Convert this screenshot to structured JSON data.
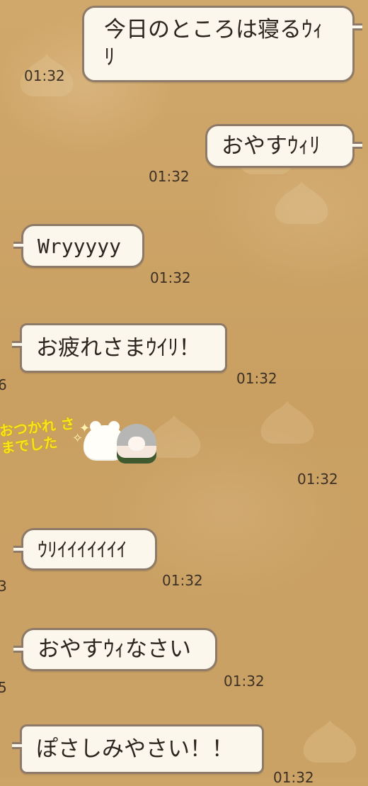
{
  "messages": [
    {
      "text": "今日のところは寝るｳｨﾘ",
      "time": "01:32"
    },
    {
      "text": "おやすｳｨﾘ",
      "time": "01:32"
    },
    {
      "text": "Wryyyyy",
      "time": "01:32"
    },
    {
      "text": "お疲れさまｳｲﾘ！",
      "time": "01:32"
    },
    {
      "sticker_text": "おつかれ\nさまでした",
      "time": "01:32"
    },
    {
      "text": "ｳﾘｲｲｲｲｲｲｲ",
      "time": "01:32"
    },
    {
      "text": "おやすｳｨなさい",
      "time": "01:32"
    },
    {
      "text": "ぽさしみやさい！！",
      "time": "01:32"
    }
  ],
  "cut_times": [
    "6",
    "3",
    "5"
  ]
}
